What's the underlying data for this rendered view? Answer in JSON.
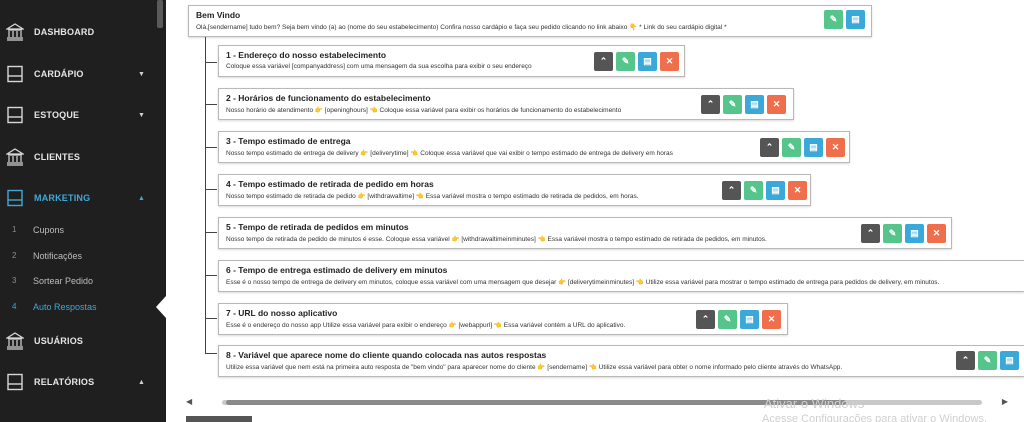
{
  "sidebar": {
    "items": [
      {
        "label": "DASHBOARD",
        "icon": "bank-icon"
      },
      {
        "label": "CARDÁPIO",
        "icon": "window-icon",
        "caret": "▼"
      },
      {
        "label": "ESTOQUE",
        "icon": "window-icon",
        "caret": "▼"
      },
      {
        "label": "CLIENTES",
        "icon": "bank-icon"
      },
      {
        "label": "MARKETING",
        "icon": "window-icon",
        "caret": "▲"
      },
      {
        "label": "USUÁRIOS",
        "icon": "bank-icon"
      },
      {
        "label": "RELATÓRIOS",
        "icon": "window-icon",
        "caret": "▲"
      }
    ],
    "sub_items": [
      {
        "num": "1",
        "label": "Cupons"
      },
      {
        "num": "2",
        "label": "Notificações"
      },
      {
        "num": "3",
        "label": "Sortear Pedido"
      },
      {
        "num": "4",
        "label": "Auto Respostas"
      }
    ]
  },
  "root": {
    "title": "Bem Vindo",
    "desc": "Olá,[sendername] tudo bem? Seja bem vindo (a) ao (nome do seu estabelecimento) Confira nosso cardápio e faça seu pedido clicando no link abaixo 👇 * Link do seu cardápio digital *"
  },
  "nodes": [
    {
      "title": "1 - Endereço do nosso estabelecimento",
      "desc": "Coloque essa variável [companyaddress] com uma mensagem da sua escolha para exibir o seu endereço"
    },
    {
      "title": "2 - Horários de funcionamento do estabelecimento",
      "desc": "Nosso horário de atendimento 👉 [openinghours] 👈 Coloque essa variável para exibir os horários de funcionamento do estabelecimento"
    },
    {
      "title": "3 - Tempo estimado de entrega",
      "desc": "Nosso tempo estimado de entrega de delivery 👉 [deliverytime] 👈 Coloque essa variável que vai exibir o tempo estimado de entrega de delivery em horas"
    },
    {
      "title": "4 - Tempo estimado de retirada de pedido em horas",
      "desc": "Nosso tempo estimado de retirada de pedido 👉 [withdrawaltime] 👈 Essa variável mostra o tempo estimado de retirada de pedidos, em horas."
    },
    {
      "title": "5 - Tempo de retirada de pedidos em minutos",
      "desc": "Nosso tempo de retirada de pedido de minutos é esse. Coloque essa variável 👉 [withdrawaltimeinminutes] 👈 Essa variável mostra o tempo estimado de retirada de pedidos, em minutos."
    },
    {
      "title": "6 - Tempo de entrega estimado de delivery em minutos",
      "desc": "Esse é o nosso tempo de entrega de delivery em minutos, coloque essa variável com uma mensagem que desejar 👉 [deliverytimeinminutes] 👈 Utilize essa variável para mostrar o tempo estimado de entrega para pedidos de delivery, em minutos."
    },
    {
      "title": "7 - URL do nosso aplicativo",
      "desc": "Esse é o endereço do nosso app Utilize essa variável para exibir o endereço 👉 [webappurl] 👈 Essa variável contém a URL do aplicativo."
    },
    {
      "title": "8 - Variável que aparece nome do cliente quando colocada nas autos respostas",
      "desc": "Utilize essa variável que nem está na primeira auto resposta de \"bem vindo\" para aparecer nome do cliente 👉 [sendername] 👈 Utilize essa variável para obter o nome informado pelo cliente através do WhatsApp."
    }
  ],
  "buttons": {
    "move": "⌃",
    "edit": "✎",
    "view": "▤",
    "delete": "✕"
  },
  "scrollbar": {
    "left": "◀",
    "right": "▶"
  },
  "watermark": {
    "line1": "Ativar o Windows",
    "line2": "Acesse Configurações para ativar o Windows."
  },
  "colors": {
    "sidebar_bg": "#1f1f1f",
    "accent": "#3fa9d6",
    "btn_dark": "#555555",
    "btn_green": "#56c58c",
    "btn_blue": "#3aa8d8",
    "btn_red": "#ef6f4d"
  }
}
